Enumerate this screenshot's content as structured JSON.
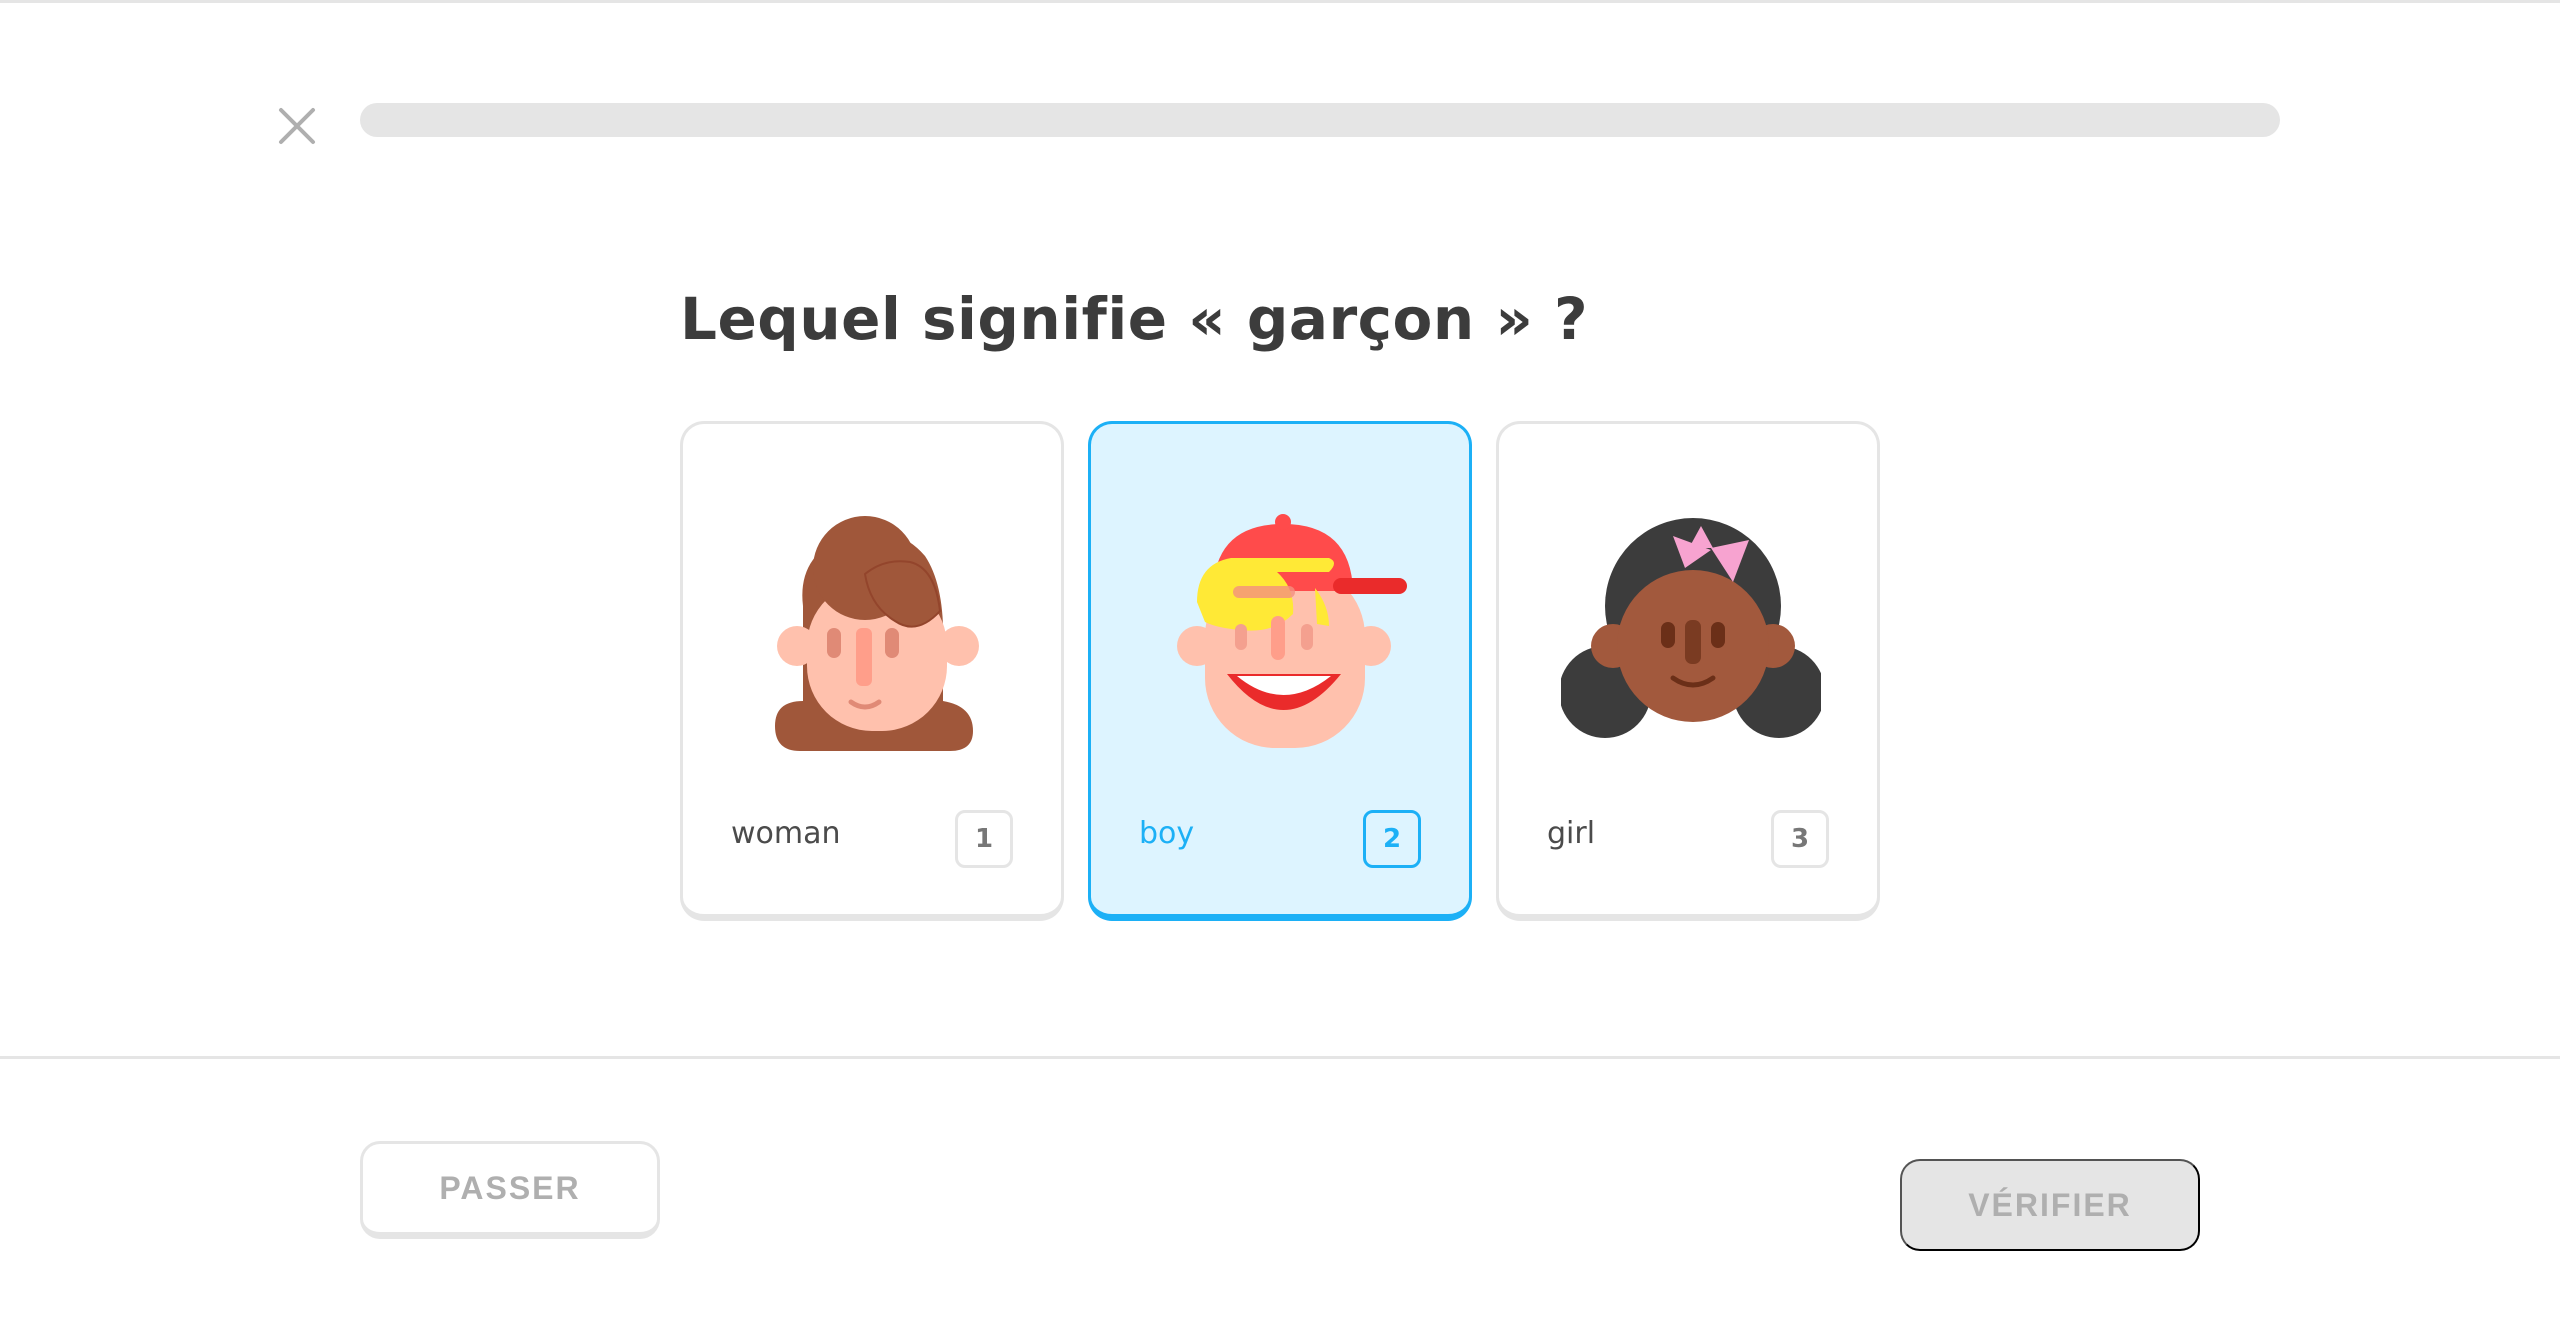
{
  "header": {
    "close_icon": "close-icon",
    "progress_fraction": 0.0
  },
  "question": {
    "text": "Lequel signifie « garçon » ?"
  },
  "choices": [
    {
      "label": "woman",
      "key": "1",
      "icon": "woman-face-icon",
      "selected": false
    },
    {
      "label": "boy",
      "key": "2",
      "icon": "boy-face-icon",
      "selected": true
    },
    {
      "label": "girl",
      "key": "3",
      "icon": "girl-face-icon",
      "selected": false
    }
  ],
  "footer": {
    "skip_label": "PASSER",
    "check_label": "VÉRIFIER"
  },
  "colors": {
    "selected_border": "#1cb0f6",
    "selected_background": "#ddf4ff",
    "neutral_border": "#e5e5e5",
    "disabled_text": "#afafaf",
    "title_text": "#3c3c3c"
  }
}
